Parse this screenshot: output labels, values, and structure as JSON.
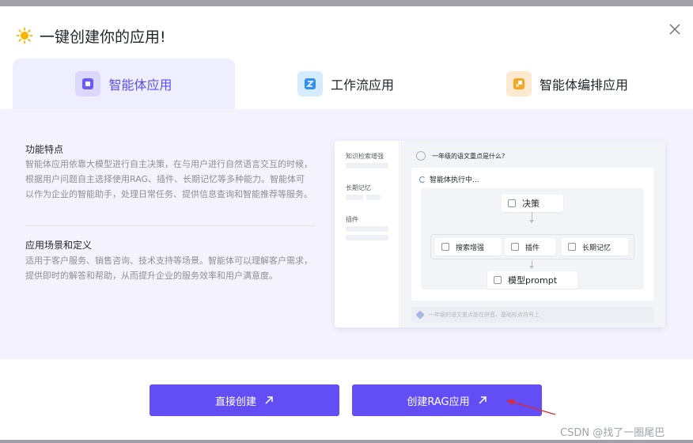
{
  "dialog": {
    "title": "一键创建你的应用!",
    "title_icon": "sun-icon",
    "close_icon": "close-icon"
  },
  "tabs": [
    {
      "label": "智能体应用",
      "icon": "agent-app-icon",
      "active": true,
      "icon_color": "#5b4df5"
    },
    {
      "label": "工作流应用",
      "icon": "workflow-icon",
      "active": false,
      "icon_color": "#2f8ff5"
    },
    {
      "label": "智能体编排应用",
      "icon": "orchestration-icon",
      "active": false,
      "icon_color": "#f5a623"
    }
  ],
  "features": {
    "title": "功能特点",
    "description": "智能体应用依靠大模型进行自主决策，在与用户进行自然语言交互的时候，根据用户问题自主选择使用RAG、插件、长期记忆等多种能力。智能体可以作为企业的智能助手，处理日常任务、提供信息查询和智能推荐等服务。"
  },
  "scenarios": {
    "title": "应用场景和定义",
    "description": "适用于客户服务、销售咨询、技术支持等场景。智能体可以理解客户需求，提供即时的解答和帮助，从而提升企业的服务效率和用户满意度。"
  },
  "preview": {
    "sidebar": [
      "知识检索增强",
      "长期记忆",
      "插件"
    ],
    "question": "一年级的语文重点是什么?",
    "status": "智能体执行中...",
    "nodes": {
      "decision": "决策",
      "search": "搜索增强",
      "plugin": "插件",
      "memory": "长期记忆",
      "model": "模型prompt"
    },
    "input_text": "一年级的语文重点是在拼音、基础标点符号上"
  },
  "buttons": {
    "direct_create": "直接创建",
    "create_rag": "创建RAG应用"
  },
  "watermark": "CSDN @找了一圈尾巴",
  "colors": {
    "accent": "#634df5",
    "tab_active_bg": "#eeeefe",
    "content_bg": "#f4f3fd",
    "annotation_arrow": "#e02b2b"
  }
}
